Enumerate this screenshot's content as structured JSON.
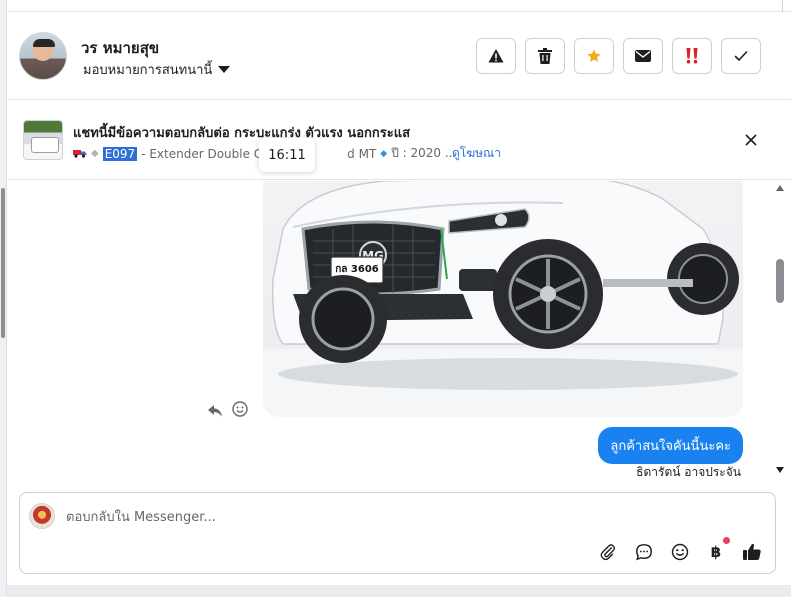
{
  "header": {
    "contact_name": "วร หมายสุข",
    "assign_label": "มอบหมายการสนทนานี้",
    "actions": [
      {
        "name": "report-button",
        "icon": "warning-icon"
      },
      {
        "name": "delete-button",
        "icon": "trash-icon"
      },
      {
        "name": "star-button",
        "icon": "star-icon"
      },
      {
        "name": "mark-unread-button",
        "icon": "envelope-icon"
      },
      {
        "name": "mark-urgent-button",
        "icon": "double-exclamation-icon"
      },
      {
        "name": "mark-done-button",
        "icon": "check-icon"
      }
    ]
  },
  "ad": {
    "title": "แชทนี้มีข้อความตอบกลับต่อ กระบะแกร่ง ตัวแรง นอกกระแส",
    "code": "E097",
    "description_start": "- Extender Double Cab",
    "description_end": "d MT",
    "year_text": "ปี : 2020 ...",
    "view_ad_link": "ดูโฆษณา"
  },
  "tooltip": {
    "time": "16:11"
  },
  "messages": {
    "car_plate": "กล 3606",
    "bubble_text": "ลูกค้าสนใจคันนี้นะคะ",
    "sender_name": "ธิดารัตน์ อาจประจัน"
  },
  "composer": {
    "placeholder": "ตอบกลับใน Messenger...",
    "baht_symbol": "฿"
  },
  "colors": {
    "accent": "#1a82f0",
    "link": "#2f6fd6",
    "star": "#f5a623",
    "urgent": "#d8232a",
    "notification": "#e4405f"
  }
}
